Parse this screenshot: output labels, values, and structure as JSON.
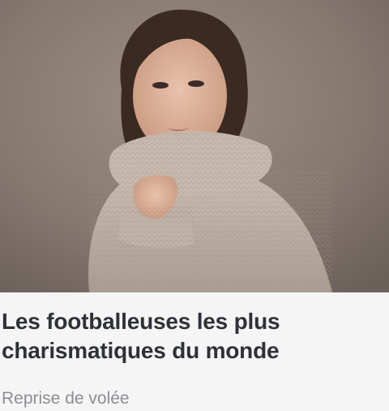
{
  "article": {
    "image_alt": "Portrait d'une footballeuse en pull à col roulé",
    "title": "Les footballeuses les plus charismatiques du monde",
    "source": "Reprise de volée"
  }
}
